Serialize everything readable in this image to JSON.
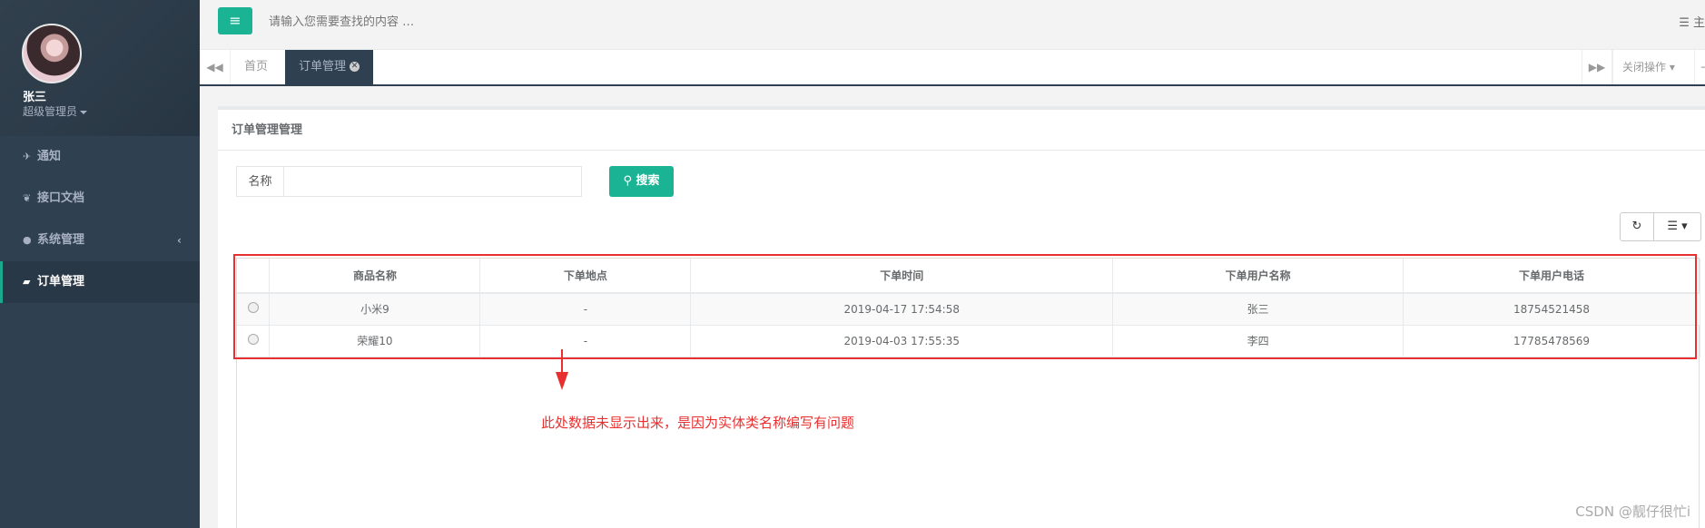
{
  "sidebar": {
    "user_name": "张三",
    "user_role": "超级管理员",
    "items": [
      {
        "label": "通知",
        "icon": "rocket-icon"
      },
      {
        "label": "接口文档",
        "icon": "leaf-icon"
      },
      {
        "label": "系统管理",
        "icon": "user-icon"
      },
      {
        "label": "订单管理",
        "icon": "graduation-cap-icon"
      }
    ]
  },
  "header": {
    "search_placeholder": "请输入您需要查找的内容 …",
    "right_text": "主"
  },
  "tabs": {
    "home": "首页",
    "active": "订单管理",
    "close_ops": "关闭操作"
  },
  "panel": {
    "title": "订单管理管理",
    "filter_label": "名称",
    "search_button": "搜索"
  },
  "table": {
    "headers": [
      "商品名称",
      "下单地点",
      "下单时间",
      "下单用户名称",
      "下单用户电话"
    ],
    "rows": [
      [
        "小米9",
        "-",
        "2019-04-17 17:54:58",
        "张三",
        "18754521458"
      ],
      [
        "荣耀10",
        "-",
        "2019-04-03 17:55:35",
        "李四",
        "17785478569"
      ]
    ]
  },
  "annotation": "此处数据未显示出来，是因为实体类名称编写有问题",
  "watermark": "CSDN @靓仔很忙i",
  "colors": {
    "accent": "#1ab394",
    "sidebar": "#2f4050",
    "annotation": "#e93030"
  }
}
